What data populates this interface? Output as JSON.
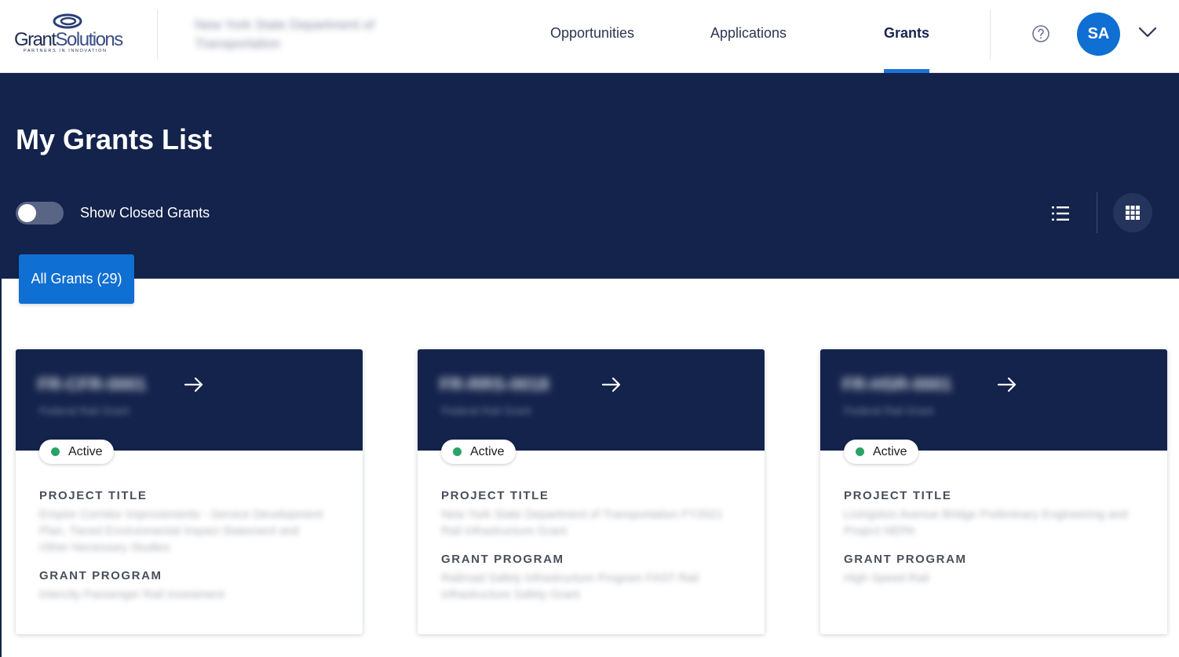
{
  "header": {
    "logo": {
      "word_part1": "Grant",
      "word_part2": "Solutions",
      "tagline": "PARTNERS IN INNOVATION"
    },
    "organization_name": "New York State Department of Transportation",
    "nav": [
      {
        "label": "Opportunities",
        "active": false
      },
      {
        "label": "Applications",
        "active": false
      },
      {
        "label": "Grants",
        "active": true
      }
    ],
    "help_icon": "question-circle-icon",
    "user_initials": "SA",
    "user_menu_icon": "chevron-down-icon"
  },
  "banner": {
    "title": "My Grants List",
    "toggle": {
      "label": "Show Closed Grants",
      "checked": false
    },
    "view_buttons": {
      "list_icon": "list-view-icon",
      "grid_icon": "grid-view-icon",
      "selected": "grid"
    },
    "tab": {
      "label": "All Grants (29)"
    }
  },
  "cards": [
    {
      "grant_number": "FR-CFR-0001",
      "grant_subtitle": "Federal Rail Grant",
      "status": "Active",
      "project_title_label": "PROJECT TITLE",
      "project_title": "Empire Corridor Improvements - Service Development Plan, Tiered Environmental Impact Statement and Other Necessary Studies",
      "grant_program_label": "GRANT PROGRAM",
      "grant_program": "Intercity Passenger Rail Investment"
    },
    {
      "grant_number": "FR-RRS-0018",
      "grant_subtitle": "Federal Rail Grant",
      "status": "Active",
      "project_title_label": "PROJECT TITLE",
      "project_title": "New York State Department of Transportation FY2021 Rail Infrastructure Grant",
      "grant_program_label": "GRANT PROGRAM",
      "grant_program": "Railroad Safety Infrastructure Program FAST Rail Infrastructure Safety Grant"
    },
    {
      "grant_number": "FR-HSR-0001",
      "grant_subtitle": "Federal Rail Grant",
      "status": "Active",
      "project_title_label": "PROJECT TITLE",
      "project_title": "Livingston Avenue Bridge Preliminary Engineering and Project NEPA",
      "grant_program_label": "GRANT PROGRAM",
      "grant_program": "High Speed Rail"
    }
  ],
  "colors": {
    "navy": "#13234b",
    "accent_blue": "#0f6fd3",
    "underline_blue": "#1a73d9",
    "status_green": "#2aa264"
  }
}
